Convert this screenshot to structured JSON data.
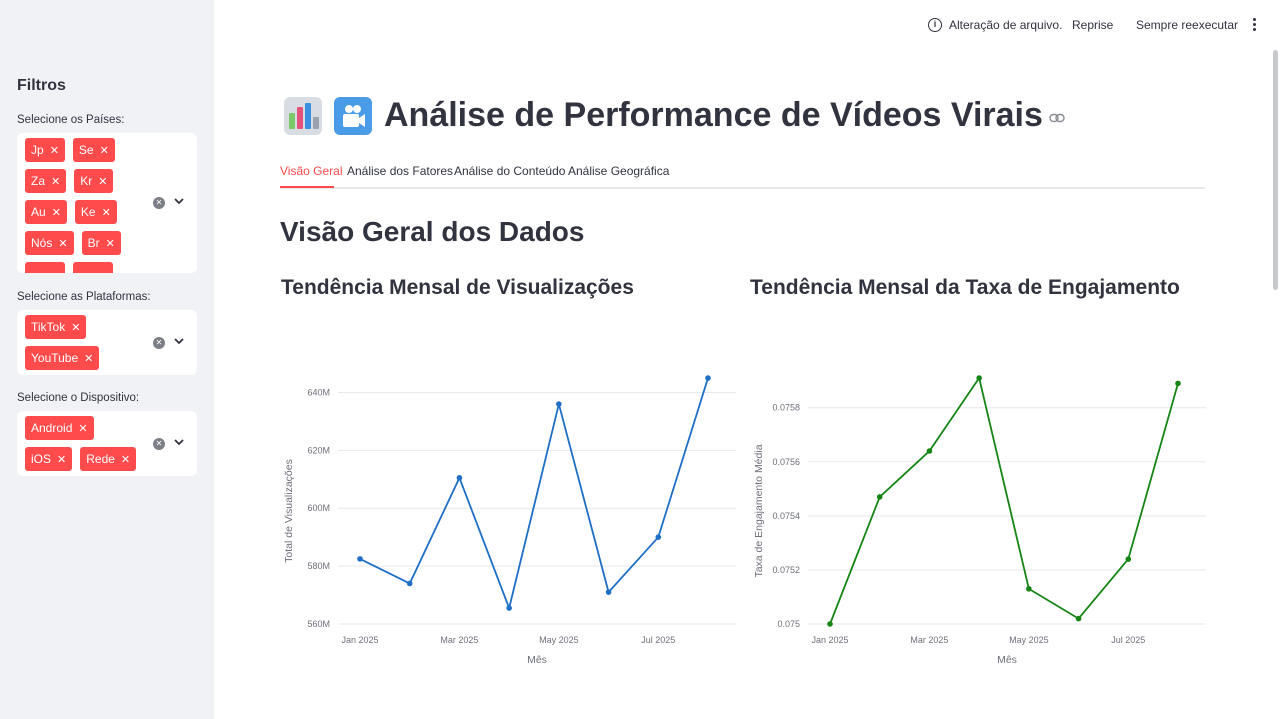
{
  "sidebar": {
    "title": "Filtros",
    "countries": {
      "label": "Selecione os Países:",
      "tags": [
        "Jp",
        "Se",
        "Za",
        "Kr",
        "Au",
        "Ke",
        "Nós",
        "Br",
        "",
        ""
      ]
    },
    "platforms": {
      "label": "Selecione as Plataformas:",
      "tags": [
        "TikTok",
        "YouTube"
      ]
    },
    "devices": {
      "label": "Selecione o Dispositivo:",
      "tags": [
        "Android",
        "iOS",
        "Rede"
      ]
    }
  },
  "toolbar": {
    "status": "Alteração de arquivo.",
    "rerun": "Reprise",
    "always_rerun": "Sempre reexecutar"
  },
  "page": {
    "title": "Análise de Performance de Vídeos Virais",
    "tabs": [
      "Visão Geral",
      "Análise dos Fatores",
      "Análise do Conteúdo",
      "Análise Geográfica"
    ],
    "active_tab": 0,
    "section_title": "Visão Geral dos Dados"
  },
  "chart_data": [
    {
      "type": "line",
      "title": "Tendência Mensal de Visualizações",
      "xlabel": "Mês",
      "ylabel": "Total de Visualizações",
      "x": [
        "Jan 2025",
        "Feb 2025",
        "Mar 2025",
        "Apr 2025",
        "May 2025",
        "Jun 2025",
        "Jul 2025",
        "Aug 2025"
      ],
      "x_tick_labels": [
        "Jan 2025",
        "Mar 2025",
        "May 2025",
        "Jul 2025"
      ],
      "y_tick_labels": [
        "560M",
        "580M",
        "600M",
        "620M",
        "640M"
      ],
      "ylim": [
        560,
        645
      ],
      "y_ticks": [
        560,
        580,
        600,
        620,
        640
      ],
      "series": [
        {
          "values": [
            582.5,
            574,
            610.5,
            565.5,
            636,
            571,
            590,
            645
          ],
          "color": "#1f6fc5"
        }
      ]
    },
    {
      "type": "line",
      "title": "Tendência Mensal da Taxa de Engajamento",
      "xlabel": "Mês",
      "ylabel": "Taxa de Engajamento Média",
      "x": [
        "Jan 2025",
        "Feb 2025",
        "Mar 2025",
        "Apr 2025",
        "May 2025",
        "Jun 2025",
        "Jul 2025",
        "Aug 2025"
      ],
      "x_tick_labels": [
        "Jan 2025",
        "Mar 2025",
        "May 2025",
        "Jul 2025"
      ],
      "y_tick_labels": [
        "0.075",
        "0.0752",
        "0.0754",
        "0.0756",
        "0.0758"
      ],
      "ylim": [
        0.075,
        0.07591
      ],
      "y_ticks": [
        0.075,
        0.0752,
        0.0754,
        0.0756,
        0.0758
      ],
      "series": [
        {
          "values": [
            0.075,
            0.07547,
            0.07564,
            0.07591,
            0.07513,
            0.07502,
            0.07524,
            0.07589
          ],
          "color": "#168516"
        }
      ]
    }
  ]
}
